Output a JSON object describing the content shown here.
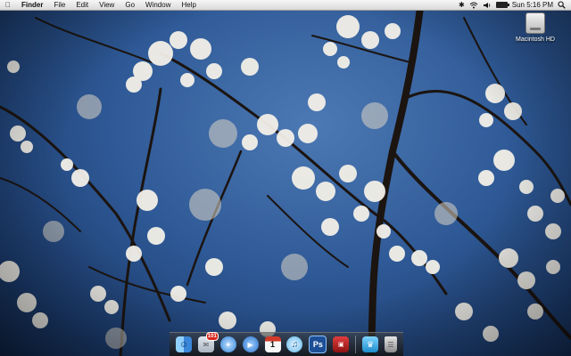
{
  "menubar": {
    "apple_icon": "apple-icon",
    "items": [
      {
        "label": "Finder",
        "bold": true
      },
      {
        "label": "File"
      },
      {
        "label": "Edit"
      },
      {
        "label": "View"
      },
      {
        "label": "Go"
      },
      {
        "label": "Window"
      },
      {
        "label": "Help"
      }
    ],
    "status_icons": [
      "bluetooth-icon",
      "wifi-icon",
      "volume-icon",
      "battery-icon"
    ],
    "battery_level": 1.0,
    "clock": "Sun 5:16 PM",
    "search_icon": "spotlight-icon"
  },
  "desktop": {
    "wallpaper": "blossom-branches-blue-sky",
    "icons": [
      {
        "label": "Macintosh HD",
        "icon": "hard-drive-icon"
      }
    ]
  },
  "dock": {
    "apps": [
      {
        "icon": "finder-icon",
        "color": "#4a9be0"
      },
      {
        "icon": "mail-icon",
        "color": "#c6cfd8",
        "badge": "101"
      },
      {
        "icon": "safari-icon",
        "color": "#3b8ee6"
      },
      {
        "icon": "ichat-icon",
        "color": "#3d7fd6"
      },
      {
        "icon": "ical-icon",
        "color": "#f4f4f4",
        "calendar_day": "1"
      },
      {
        "icon": "itunes-icon",
        "color": "#6dc0f0"
      },
      {
        "icon": "photoshop-icon",
        "color": "#1f5ba8",
        "text": "Ps"
      },
      {
        "icon": "photo-booth-icon",
        "color": "#c32121"
      },
      {
        "icon": "app-crown-icon",
        "color": "#2aa6dd"
      }
    ],
    "trash_icon": "trash-icon"
  }
}
